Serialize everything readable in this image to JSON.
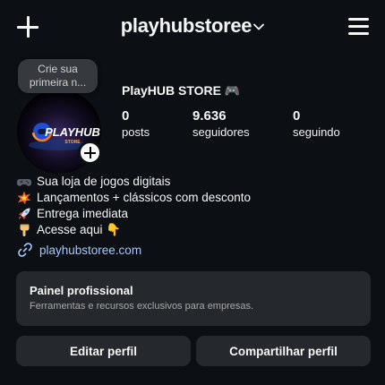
{
  "header": {
    "username": "playhubstoree",
    "new_post_icon": "plus-icon",
    "username_dropdown_icon": "chevron-down-icon",
    "menu_icon": "hamburger-menu-icon"
  },
  "profile": {
    "story_note_line1": "Crie sua",
    "story_note_line2": "primeira n...",
    "avatar_logo_text": "PLAYHUB",
    "avatar_logo_subtext": "STORE",
    "add_story_icon": "plus-icon",
    "display_name": "PlayHUB STORE 🎮",
    "stats": [
      {
        "value": "0",
        "label": "posts"
      },
      {
        "value": "9.636",
        "label": "seguidores"
      },
      {
        "value": "0",
        "label": "seguindo"
      }
    ]
  },
  "bio": {
    "lines": [
      {
        "icon": "game-controller-emoji",
        "text": "Sua loja de jogos digitais"
      },
      {
        "icon": "collision-emoji",
        "text": "Lançamentos + clássicos com desconto"
      },
      {
        "icon": "rocket-emoji",
        "text": "Entrega imediata"
      },
      {
        "icon": "pointing-down-emoji",
        "text": "Acesse aqui 👇"
      }
    ],
    "link_icon": "link-icon",
    "link": "playhubstoree.com"
  },
  "professional_panel": {
    "title": "Painel profissional",
    "subtitle": "Ferramentas e recursos exclusivos para empresas."
  },
  "actions": {
    "edit_profile": "Editar perfil",
    "share_profile": "Compartilhar perfil"
  },
  "colors": {
    "background": "#0c1014",
    "surface": "#25292e",
    "link": "#a8c7fa",
    "text": "#f5f5f5",
    "muted": "#a8a8a8"
  }
}
